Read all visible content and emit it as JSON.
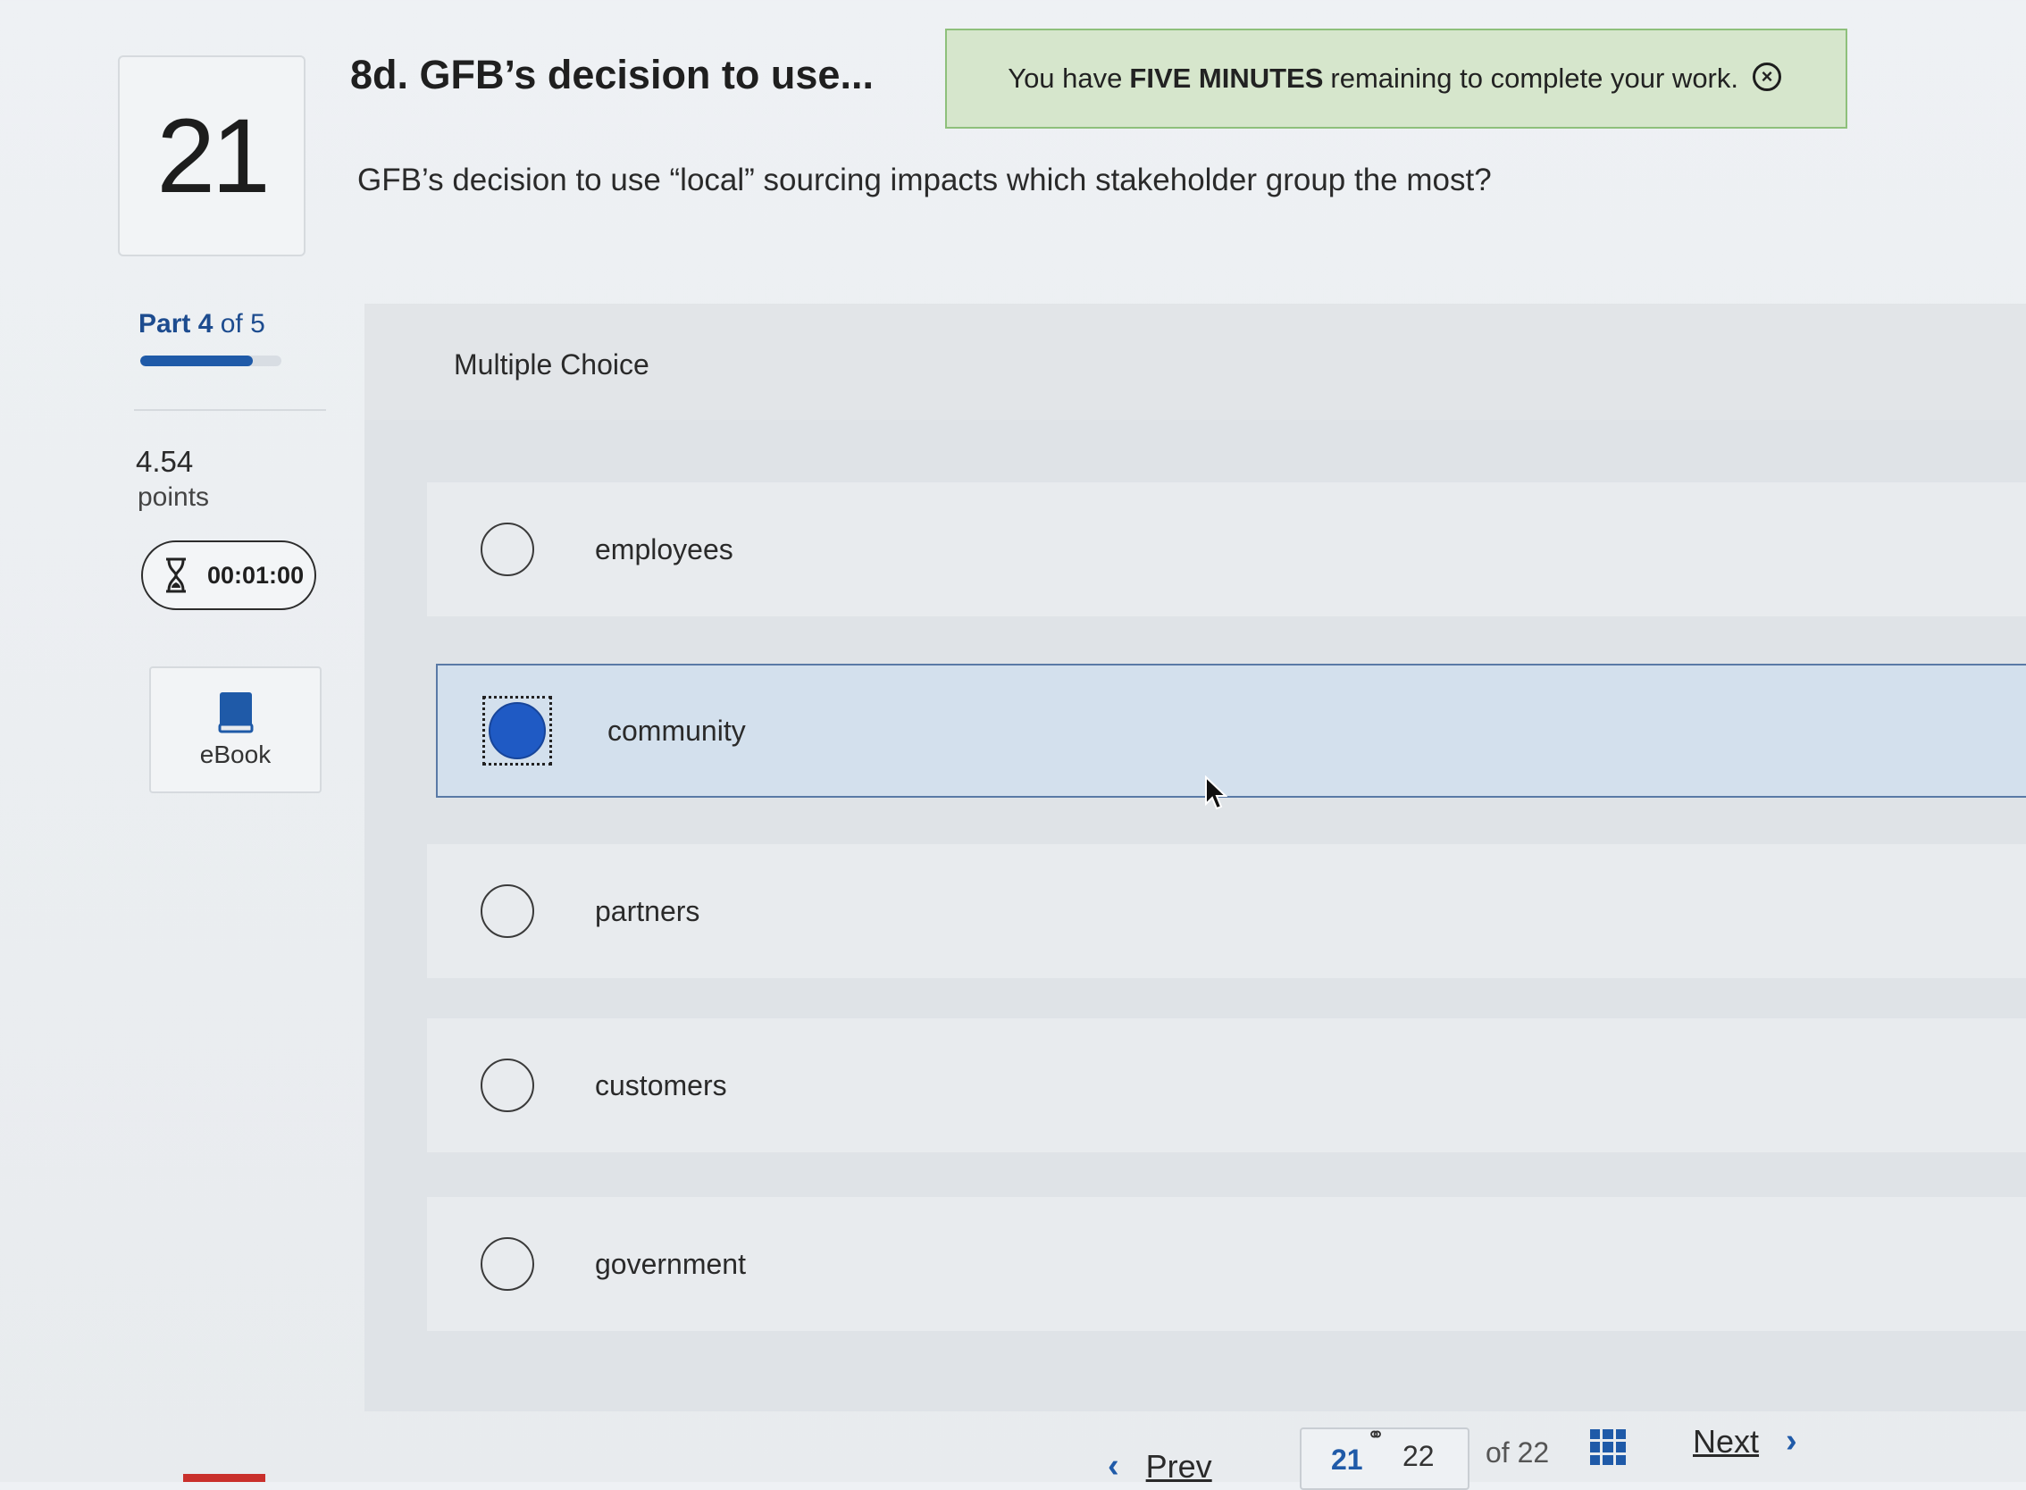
{
  "question": {
    "number": "21",
    "title": "8d. GFB’s decision to use...",
    "text": "GFB’s decision to use “local” sourcing impacts which stakeholder group the most?"
  },
  "alert": {
    "prefix": "You have",
    "emphasis": "FIVE MINUTES",
    "suffix": "remaining to complete your work.",
    "close_icon": "close-circle-icon"
  },
  "sidebar": {
    "part_label": "Part",
    "part_current": "4",
    "part_of": "of 5",
    "part_progress": 0.8,
    "points_value": "4.54",
    "points_label": "points",
    "timer": "00:01:00",
    "timer_icon": "hourglass-icon",
    "ebook_label": "eBook",
    "ebook_icon": "book-icon"
  },
  "answer": {
    "type_label": "Multiple Choice",
    "options": [
      {
        "label": "employees",
        "selected": false
      },
      {
        "label": "community",
        "selected": true
      },
      {
        "label": "partners",
        "selected": false
      },
      {
        "label": "customers",
        "selected": false
      },
      {
        "label": "government",
        "selected": false
      }
    ]
  },
  "footer": {
    "prev_label": "Prev",
    "current_page": "21",
    "next_page": "22",
    "of_total": "of 22",
    "next_label": "Next"
  },
  "colors": {
    "accent": "#1f5aa8",
    "alert_bg": "#d6e6cc",
    "alert_border": "#8ec07b",
    "selected_bg": "#d3e0ed"
  }
}
